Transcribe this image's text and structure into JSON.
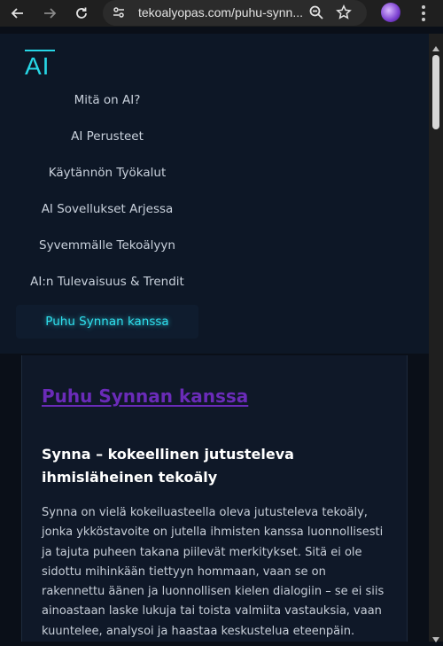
{
  "browser": {
    "url": "tekoalyopas.com/puhu-synn...",
    "icons": [
      "back-arrow-icon",
      "forward-arrow-icon",
      "reload-icon",
      "site-settings-icon",
      "zoom-icon",
      "bookmark-star-icon",
      "extension-icon",
      "more-vert-icon"
    ]
  },
  "site": {
    "logo": "AI",
    "accent_color": "#27d6e5",
    "menu": [
      {
        "label": "Mitä on AI?"
      },
      {
        "label": "AI Perusteet"
      },
      {
        "label": "Käytännön Työkalut"
      },
      {
        "label": "AI Sovellukset Arjessa"
      },
      {
        "label": "Syvemmälle Tekoälyyn"
      },
      {
        "label": "AI:n Tulevaisuus & Trendit"
      },
      {
        "label": "Puhu Synnan kanssa",
        "active": true
      }
    ]
  },
  "content": {
    "title": "Puhu Synnan kanssa",
    "title_color": "#6a2bb8",
    "subtitle": "Synna – kokeellinen jutusteleva ihmisläheinen tekoäly",
    "paragraph": "Synna on vielä kokeiluasteella oleva jutusteleva tekoäly, jonka ykköstavoite on jutella ihmisten kanssa luonnollisesti ja tajuta puheen takana piilevät merkitykset. Sitä ei ole sidottu mihinkään tiettyyn hommaan, vaan se on rakennettu äänen ja luonnollisen kielen dialogiin – se ei siis ainoastaan laske lukuja tai toista valmiita vastauksia, vaan kuuntelee, analysoi ja haastaa keskustelua eteenpäin."
  }
}
